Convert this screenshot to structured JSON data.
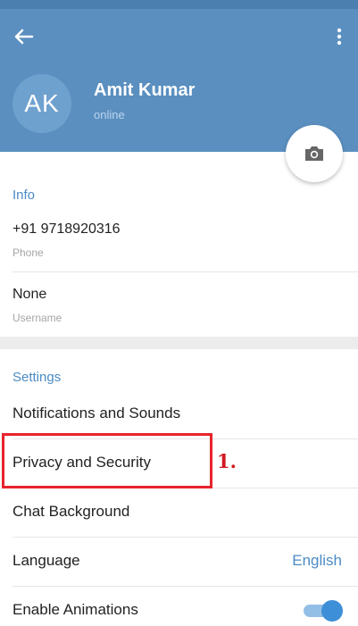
{
  "header": {
    "avatar_initials": "AK",
    "name": "Amit Kumar",
    "status": "online"
  },
  "info": {
    "title": "Info",
    "phone_value": "+91 9718920316",
    "phone_label": "Phone",
    "username_value": "None",
    "username_label": "Username"
  },
  "settings": {
    "title": "Settings",
    "items": [
      {
        "label": "Notifications and Sounds"
      },
      {
        "label": "Privacy and Security"
      },
      {
        "label": "Chat Background"
      },
      {
        "label": "Language",
        "value": "English"
      },
      {
        "label": "Enable Animations",
        "toggle_on": true
      }
    ]
  },
  "annotation": {
    "step_label": "1."
  },
  "colors": {
    "header": "#5a8fc0",
    "accent": "#4b8bc5",
    "highlight": "#e8232c"
  }
}
